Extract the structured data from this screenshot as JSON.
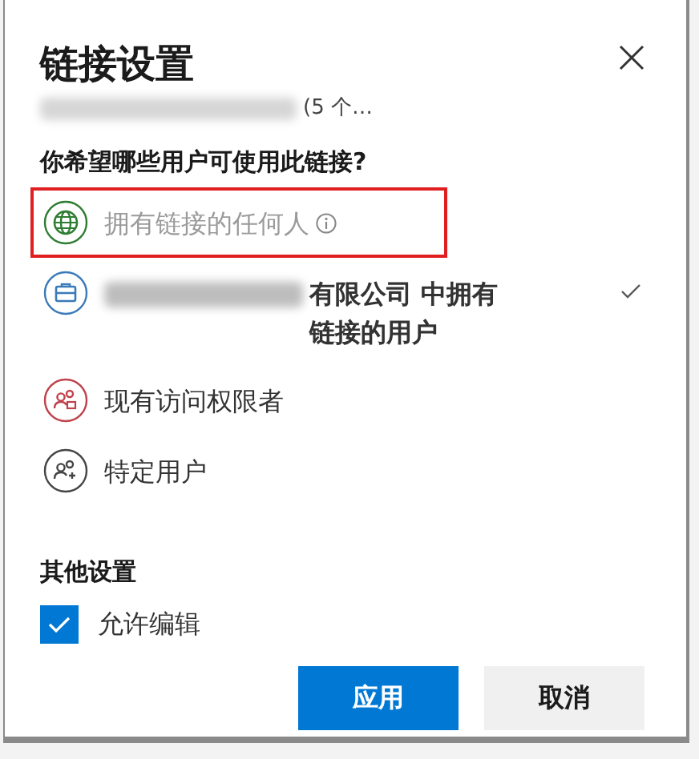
{
  "dialog": {
    "title": "链接设置",
    "subtitle": "(5 个…"
  },
  "question": "你希望哪些用户可使用此链接?",
  "options": [
    {
      "kind": "globe",
      "label": "拥有链接的任何人",
      "disabled": true,
      "selected": false,
      "highlighted": true,
      "info": true,
      "redacted": false
    },
    {
      "kind": "org",
      "label": "有限公司 中拥有链接的用户",
      "disabled": false,
      "selected": true,
      "highlighted": false,
      "info": false,
      "redacted": true
    },
    {
      "kind": "existing",
      "label": "现有访问权限者",
      "disabled": false,
      "selected": false,
      "highlighted": false,
      "info": false,
      "redacted": false
    },
    {
      "kind": "specific",
      "label": "特定用户",
      "disabled": false,
      "selected": false,
      "highlighted": false,
      "info": false,
      "redacted": false
    }
  ],
  "other_settings": {
    "heading": "其他设置",
    "allow_edit": {
      "label": "允许编辑",
      "checked": true
    }
  },
  "buttons": [
    {
      "kind": "primary",
      "label": "应用"
    },
    {
      "kind": "secondary",
      "label": "取消"
    }
  ]
}
